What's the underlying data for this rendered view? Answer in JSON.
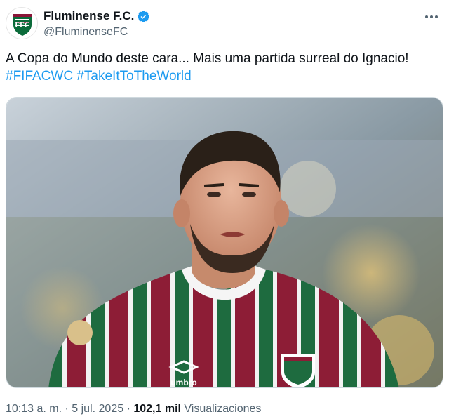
{
  "account": {
    "display_name": "Fluminense F.C.",
    "handle": "@FluminenseFC",
    "verified": true,
    "avatar_icon": "fluminense-crest-icon",
    "verified_icon": "verified-badge-icon",
    "verified_color": "#1d9bf0"
  },
  "tweet": {
    "text": "A Copa do Mundo deste cara... Mais uma partida surreal do Ignacio!",
    "hashtags": [
      "#FIFACWC",
      "#TakeItToTheWorld"
    ],
    "hashtag_color": "#1d9bf0"
  },
  "media": {
    "type": "photo",
    "shirt_brand": "umbro"
  },
  "meta": {
    "time": "10:13 a. m.",
    "separator": "·",
    "date": "5 jul. 2025",
    "views_count": "102,1 mil",
    "views_label": "Visualizaciones"
  },
  "more_icon": "more-options-icon"
}
